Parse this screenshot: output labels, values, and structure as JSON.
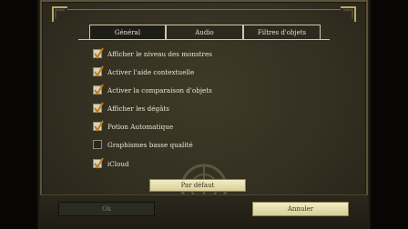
{
  "tabs": [
    {
      "label": "Général",
      "active": true
    },
    {
      "label": "Audio",
      "active": false
    },
    {
      "label": "Filtres d'objets",
      "active": false
    }
  ],
  "options": [
    {
      "label": "Afficher le niveau des monstres",
      "checked": true
    },
    {
      "label": "Activer l'aide contextuelle",
      "checked": true
    },
    {
      "label": "Activer la comparaison d'objets",
      "checked": true
    },
    {
      "label": "Afficher les dégâts",
      "checked": true
    },
    {
      "label": "Potion Automatique",
      "checked": true
    },
    {
      "label": "Graphismes basse qualité",
      "checked": false
    },
    {
      "label": "iCloud",
      "checked": true
    }
  ],
  "buttons": {
    "default_label": "Par défaut",
    "ok_label": "Ok",
    "cancel_label": "Annuler"
  },
  "colors": {
    "text": "#ece6d2",
    "button_fill": "#e8e0b0",
    "disabled_button": "#2a2c22",
    "panel": "#332f21"
  }
}
